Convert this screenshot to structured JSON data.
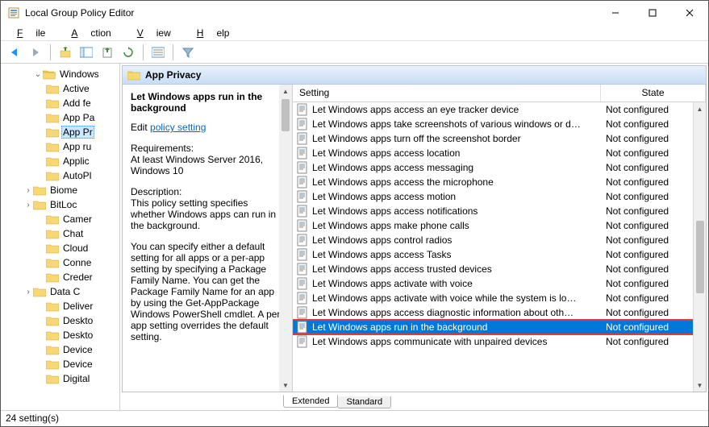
{
  "titlebar": {
    "title": "Local Group Policy Editor"
  },
  "menubar": {
    "file": "File",
    "action": "Action",
    "view": "View",
    "help": "Help"
  },
  "tree": {
    "parent": "Windows",
    "items": [
      "Active",
      "Add fe",
      "App Pa",
      "App Pr",
      "App ru",
      "Applic",
      "AutoPl",
      "Biome",
      "BitLoc",
      "Camer",
      "Chat",
      "Cloud",
      "Conne",
      "Creder",
      "Data C",
      "Deliver",
      "Deskto",
      "Deskto",
      "Device",
      "Device",
      "Digital"
    ],
    "selectedIndex": 3,
    "expandable": {
      "7": true,
      "8": true,
      "14": true
    }
  },
  "panel": {
    "header": "App Privacy",
    "desc": {
      "title": "Let Windows apps run in the background",
      "editPrefix": "Edit",
      "editLink": "policy setting",
      "reqTitle": "Requirements:",
      "reqBody": "At least Windows Server 2016, Windows 10",
      "descTitle": "Description:",
      "descBody1": "This policy setting specifies whether Windows apps can run in the background.",
      "descBody2": "You can specify either a default setting for all apps or a per-app setting by specifying a Package Family Name. You can get the Package Family Name for an app by using the Get-AppPackage Windows PowerShell cmdlet. A per-app setting overrides the default setting."
    },
    "columns": {
      "setting": "Setting",
      "state": "State"
    },
    "rows": [
      {
        "s": "Let Windows apps access an eye tracker device",
        "st": "Not configured"
      },
      {
        "s": "Let Windows apps take screenshots of various windows or d…",
        "st": "Not configured"
      },
      {
        "s": "Let Windows apps turn off the screenshot border",
        "st": "Not configured"
      },
      {
        "s": "Let Windows apps access location",
        "st": "Not configured"
      },
      {
        "s": "Let Windows apps access messaging",
        "st": "Not configured"
      },
      {
        "s": "Let Windows apps access the microphone",
        "st": "Not configured"
      },
      {
        "s": "Let Windows apps access motion",
        "st": "Not configured"
      },
      {
        "s": "Let Windows apps access notifications",
        "st": "Not configured"
      },
      {
        "s": "Let Windows apps make phone calls",
        "st": "Not configured"
      },
      {
        "s": "Let Windows apps control radios",
        "st": "Not configured"
      },
      {
        "s": "Let Windows apps access Tasks",
        "st": "Not configured"
      },
      {
        "s": "Let Windows apps access trusted devices",
        "st": "Not configured"
      },
      {
        "s": "Let Windows apps activate with voice",
        "st": "Not configured"
      },
      {
        "s": "Let Windows apps activate with voice while the system is lo…",
        "st": "Not configured"
      },
      {
        "s": "Let Windows apps access diagnostic information about oth…",
        "st": "Not configured"
      },
      {
        "s": "Let Windows apps run in the background",
        "st": "Not configured"
      },
      {
        "s": "Let Windows apps communicate with unpaired devices",
        "st": "Not configured"
      }
    ],
    "selectedRow": 15
  },
  "tabs": {
    "extended": "Extended",
    "standard": "Standard"
  },
  "status": "24 setting(s)"
}
